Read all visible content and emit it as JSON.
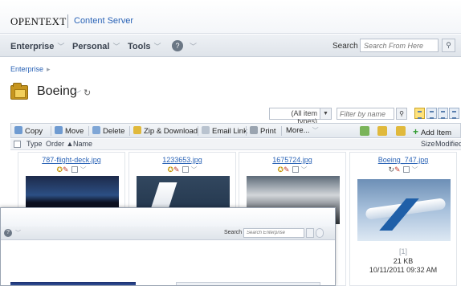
{
  "brand": {
    "logo": "OPENTEXT",
    "product": "Content Server"
  },
  "menu": {
    "items": [
      {
        "label": "Enterprise"
      },
      {
        "label": "Personal"
      },
      {
        "label": "Tools"
      }
    ],
    "help_icon": "help-icon",
    "search_label": "Search",
    "search_placeholder": "Search From Here"
  },
  "breadcrumb": {
    "items": [
      "Enterprise"
    ]
  },
  "page": {
    "title": "Boeing"
  },
  "filters": {
    "type_value": "(All item types)",
    "name_placeholder": "Filter by name"
  },
  "toolbar": {
    "copy": "Copy",
    "move": "Move",
    "delete": "Delete",
    "zip": "Zip & Download",
    "email": "Email Link",
    "print": "Print",
    "more": "More...",
    "add_item": "Add Item"
  },
  "columns": {
    "type": "Type",
    "order": "Order",
    "name": "Name",
    "size": "Size",
    "modified": "Modified"
  },
  "items": [
    {
      "name": "787-flight-deck.jpg"
    },
    {
      "name": "1233653.jpg"
    },
    {
      "name": "1675724.jpg"
    },
    {
      "name": "Boeing_747.jpg",
      "version": "[1]",
      "size": "21 KB",
      "modified": "10/11/2011 09:32 AM"
    }
  ],
  "overlay": {
    "search_label": "Search",
    "search_placeholder": "Search Enterprise"
  },
  "colors": {
    "link": "#2a63b6",
    "accent_add": "#2e9a2e"
  }
}
